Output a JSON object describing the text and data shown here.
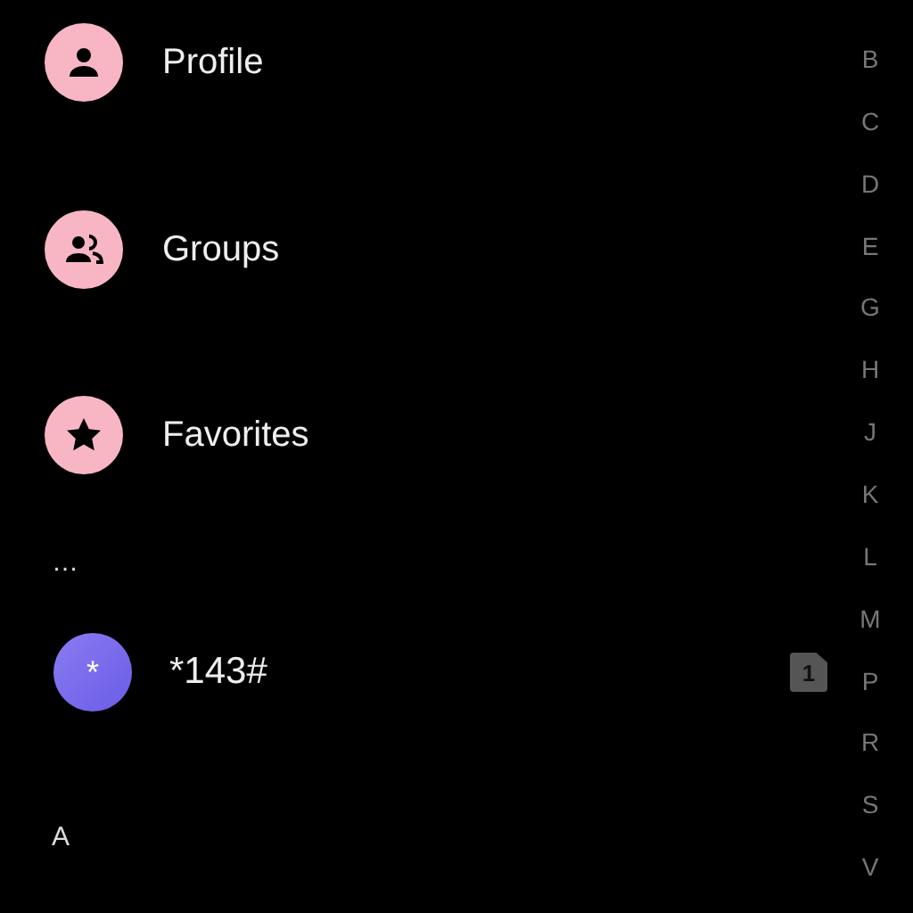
{
  "shortcuts": [
    {
      "label": "Profile",
      "kind": "person"
    },
    {
      "label": "Groups",
      "kind": "group"
    },
    {
      "label": "Favorites",
      "kind": "star"
    }
  ],
  "sections": [
    {
      "header": "…",
      "contacts": [
        {
          "name": "*143#",
          "avatar": "*",
          "sim": "1"
        }
      ]
    },
    {
      "header": "A"
    }
  ],
  "index": [
    "B",
    "C",
    "D",
    "E",
    "G",
    "H",
    "J",
    "K",
    "L",
    "M",
    "P",
    "R",
    "S",
    "V"
  ]
}
